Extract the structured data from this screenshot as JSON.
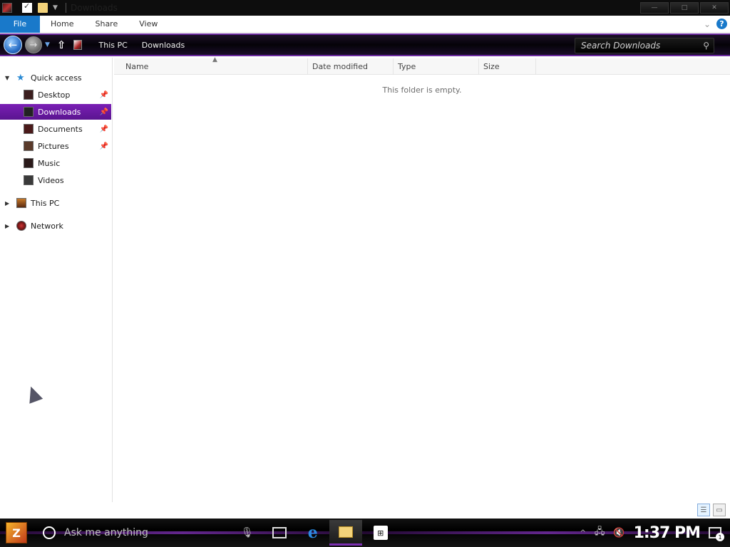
{
  "window": {
    "title": "Downloads",
    "minimize": "—",
    "maximize": "□",
    "close": "✕"
  },
  "ribbon": {
    "tabs": [
      "File",
      "Home",
      "Share",
      "View"
    ],
    "help": "?"
  },
  "address": {
    "breadcrumbs": [
      "This PC",
      "Downloads"
    ],
    "search_placeholder": "Search Downloads"
  },
  "nav": {
    "quick_access": "Quick access",
    "items": [
      {
        "label": "Desktop",
        "pinned": true
      },
      {
        "label": "Downloads",
        "pinned": true,
        "selected": true
      },
      {
        "label": "Documents",
        "pinned": true
      },
      {
        "label": "Pictures",
        "pinned": true
      },
      {
        "label": "Music",
        "pinned": false
      },
      {
        "label": "Videos",
        "pinned": false
      }
    ],
    "this_pc": "This PC",
    "network": "Network"
  },
  "columns": [
    "Name",
    "Date modified",
    "Type",
    "Size"
  ],
  "empty_message": "This folder is empty.",
  "taskbar": {
    "cortana_text": "Ask me anything",
    "clock": "1:37 PM",
    "notification_count": "1"
  },
  "colors": {
    "accent": "#7b2fb0",
    "file_tab": "#1979ca"
  }
}
